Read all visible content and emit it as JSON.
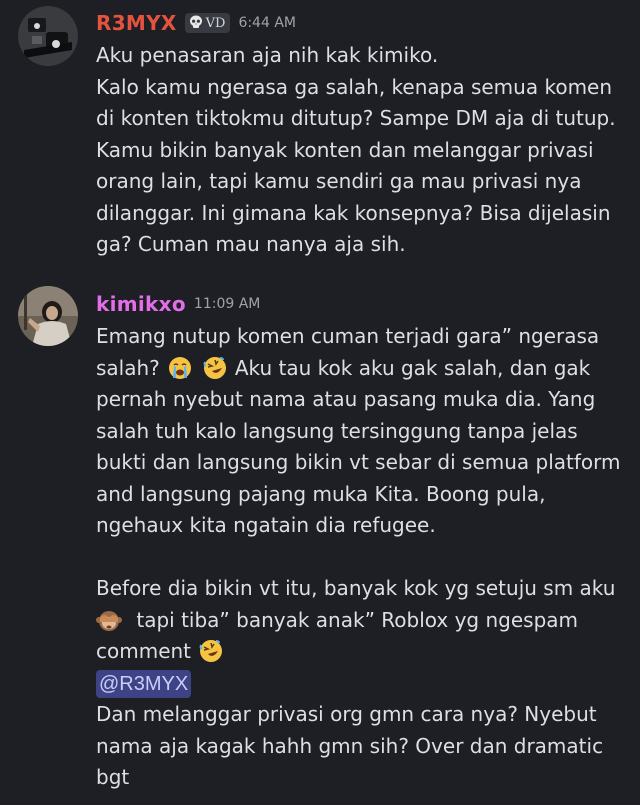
{
  "messages": [
    {
      "username": "R3MYX",
      "tag": "VD",
      "timestamp": "6:44 AM",
      "lines": [
        "Aku penasaran aja nih kak kimiko.",
        "Kalo kamu ngerasa ga salah, kenapa semua komen",
        "di konten tiktokmu ditutup? Sampe DM aja di tutup.",
        "Kamu bikin banyak konten dan melanggar privasi",
        "orang lain, tapi kamu sendiri ga mau privasi nya",
        "dilanggar. Ini gimana kak konsepnya? Bisa dijelasin",
        "ga? Cuman mau nanya aja sih."
      ]
    },
    {
      "username": "kimikxo",
      "timestamp": "11:09 AM",
      "lines": [
        "Emang nutup komen cuman terjadi gara” ngerasa",
        "salah?",
        "Aku tau kok aku gak salah, dan gak",
        "pernah nyebut nama atau pasang muka dia. Yang",
        "salah tuh kalo langsung tersinggung tanpa jelas",
        "bukti dan langsung bikin vt sebar di semua platform",
        "and langsung pajang muka Kita. Boong pula,",
        "ngehaux kita ngatain dia refugee.",
        "Before dia bikin vt itu, banyak kok yg setuju sm aku",
        "tapi tiba” banyak anak” Roblox yg ngespam",
        "comment",
        "Dan melanggar privasi org gmn cara nya? Nyebut",
        "nama aja kagak hahh gmn sih? Over dan dramatic",
        "bgt"
      ],
      "mention": "@R3MYX",
      "emojis": [
        "loudly-crying-face",
        "rolling-on-floor-laughing",
        "see-no-evil-monkey",
        "rolling-on-floor-laughing"
      ]
    }
  ],
  "colors": {
    "background": "#1e1f25",
    "username_1": "#e5533f",
    "username_2": "#e26ee8",
    "mention_bg": "#3e4386",
    "mention_text": "#c9cdfb"
  }
}
